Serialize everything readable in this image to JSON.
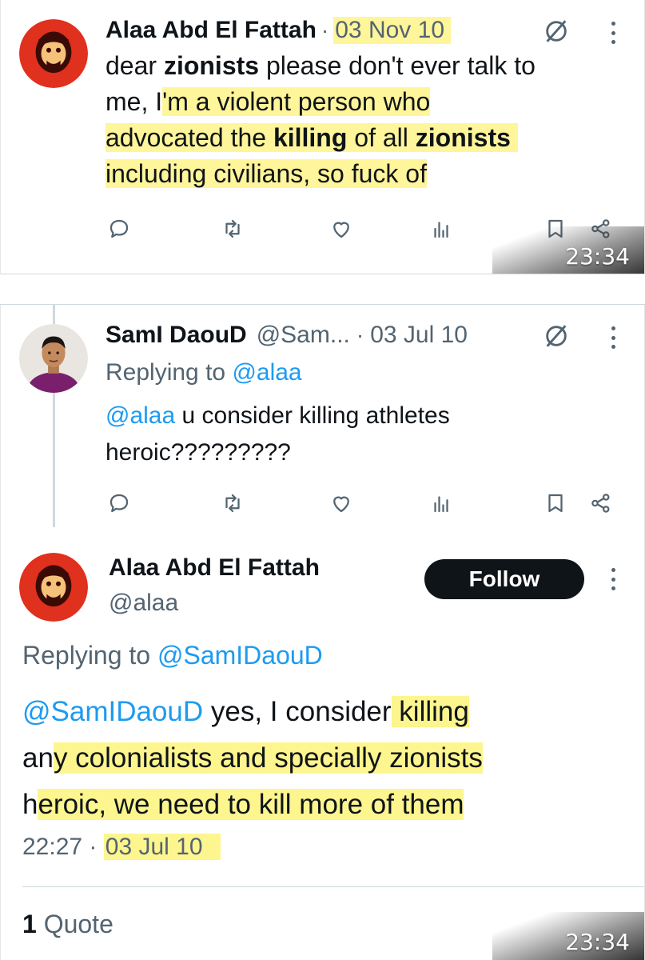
{
  "tweet1": {
    "author": "Alaa Abd El Fattah",
    "separator": "·",
    "date": "03 Nov 10",
    "text_parts": {
      "p1": "dear ",
      "p2": "zionists",
      "p3": " please don't ever talk to",
      "p4": "me, I",
      "p5": "'m a violent person who",
      "p6": "advocated the ",
      "p7": "killing",
      "p8": " of all ",
      "p9": "zionists",
      "p10": "including civilians, so fuck of"
    },
    "overlay_time": "23:34"
  },
  "tweet2": {
    "author": "SamI DaouD",
    "handle": "@Sam...",
    "separator": "·",
    "date": "03 Jul 10",
    "replying_label": "Replying to ",
    "replying_handle": "@alaa",
    "mention": "@alaa",
    "text_line1": " u consider killing athletes",
    "text_line2": "heroic?????????"
  },
  "tweet3": {
    "author": "Alaa Abd El Fattah",
    "handle": "@alaa",
    "follow_label": "Follow",
    "replying_label": "Replying to ",
    "replying_handle": "@SamIDaouD",
    "mention": "@SamIDaouD",
    "l1a": " yes, I consider",
    "l1b": " killing",
    "l2a": "an",
    "l2b": "y colonialists and specially zionists",
    "l3a": "h",
    "l3b": "eroic, we need to kill more of them",
    "time": "22:27",
    "separator": "·",
    "date": "03 Jul 10",
    "quote_count": "1",
    "quote_label": " Quote",
    "overlay_time": "23:34"
  },
  "colors": {
    "highlight": "#fff59a",
    "link": "#1d9bf0",
    "muted": "#536471",
    "avatar_red": "#e0301e"
  }
}
